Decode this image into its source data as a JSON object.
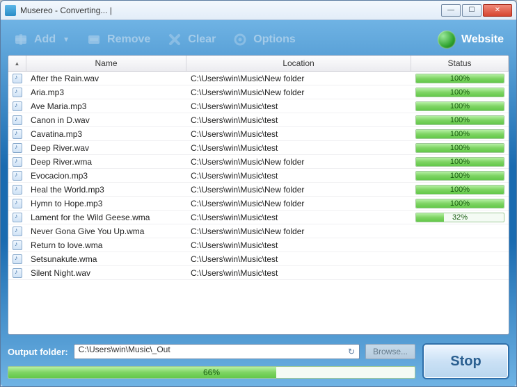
{
  "window": {
    "title": "Musereo - Converting...  |"
  },
  "toolbar": {
    "add": "Add",
    "remove": "Remove",
    "clear": "Clear",
    "options": "Options",
    "website": "Website"
  },
  "grid": {
    "headers": {
      "name": "Name",
      "location": "Location",
      "status": "Status"
    },
    "rows": [
      {
        "name": "After the Rain.wav",
        "location": "C:\\Users\\win\\Music\\New folder",
        "progress": 100
      },
      {
        "name": "Aria.mp3",
        "location": "C:\\Users\\win\\Music\\New folder",
        "progress": 100
      },
      {
        "name": "Ave Maria.mp3",
        "location": "C:\\Users\\win\\Music\\test",
        "progress": 100
      },
      {
        "name": "Canon in D.wav",
        "location": "C:\\Users\\win\\Music\\test",
        "progress": 100
      },
      {
        "name": "Cavatina.mp3",
        "location": "C:\\Users\\win\\Music\\test",
        "progress": 100
      },
      {
        "name": "Deep River.wav",
        "location": "C:\\Users\\win\\Music\\test",
        "progress": 100
      },
      {
        "name": "Deep River.wma",
        "location": "C:\\Users\\win\\Music\\New folder",
        "progress": 100
      },
      {
        "name": "Evocacion.mp3",
        "location": "C:\\Users\\win\\Music\\test",
        "progress": 100
      },
      {
        "name": "Heal the World.mp3",
        "location": "C:\\Users\\win\\Music\\New folder",
        "progress": 100
      },
      {
        "name": "Hymn to Hope.mp3",
        "location": "C:\\Users\\win\\Music\\New folder",
        "progress": 100
      },
      {
        "name": "Lament for the Wild Geese.wma",
        "location": "C:\\Users\\win\\Music\\test",
        "progress": 32
      },
      {
        "name": "Never Gona Give You Up.wma",
        "location": "C:\\Users\\win\\Music\\New folder",
        "progress": 0
      },
      {
        "name": "Return to love.wma",
        "location": "C:\\Users\\win\\Music\\test",
        "progress": 0
      },
      {
        "name": "Setsunakute.wma",
        "location": "C:\\Users\\win\\Music\\test",
        "progress": 0
      },
      {
        "name": "Silent Night.wav",
        "location": "C:\\Users\\win\\Music\\test",
        "progress": 0
      }
    ]
  },
  "output": {
    "label": "Output folder:",
    "path": "C:\\Users\\win\\Music\\_Out",
    "browse": "Browse...",
    "stop": "Stop"
  },
  "overall": {
    "progress": 66
  }
}
